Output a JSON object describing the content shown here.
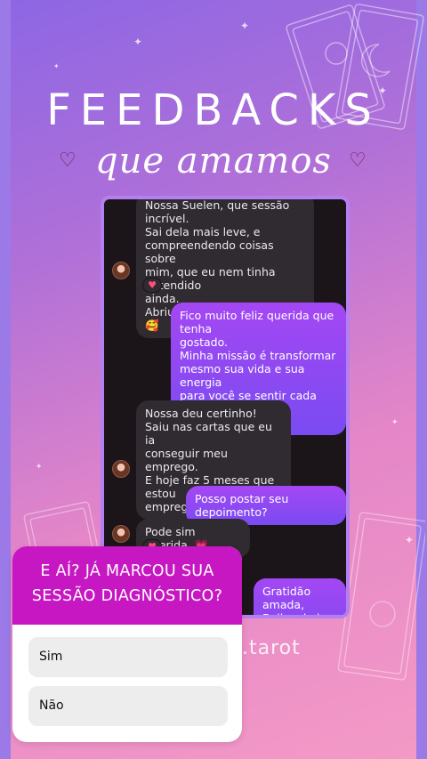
{
  "story": {
    "headline": "FEEDBACKS",
    "subheadline": "que amamos",
    "brand_watermark": ".tarot",
    "decorations": {
      "heart_left": "heart-outline-icon",
      "heart_right": "heart-outline-icon",
      "tarot_cards": [
        "THE MOON",
        "THE TOWER"
      ]
    }
  },
  "chat": {
    "messages": [
      {
        "from": "client",
        "text": "Nossa Suelen, que sessão incrível.\nSai dela mais leve, e\ncompreendendo coisas sobre\nmim, que eu nem tinha entendido\nainda.\nAbriu minha visão mesmo 🥰",
        "reaction": "♥"
      },
      {
        "from": "reader",
        "text": "Fico muito feliz querida que tenha\ngostado.\nMinha missão é transformar\nmesmo sua vida e sua energia\npara você se sentir cada vez mais\nrealizada."
      },
      {
        "from": "client",
        "text": "Nossa deu certinho!\nSaiu nas cartas que eu ia\nconseguir meu emprego.\nE hoje faz 5 meses que estou\nempregada Gratidão 🥺"
      },
      {
        "from": "reader",
        "text": "Posso postar seu depoimento?"
      },
      {
        "from": "client",
        "text": "Pode sim querida. 💗",
        "reaction": "♥"
      },
      {
        "from": "reader",
        "text": "Gratidão amada,\nBeijos de luz 🌟"
      }
    ]
  },
  "poll": {
    "question": "E AÍ? JÁ MARCOU SUA SESSÃO DIAGNÓSTICO?",
    "options": [
      "Sim",
      "Não"
    ],
    "header_color": "#c617c2"
  },
  "colors": {
    "gradient_top": "#8d66e4",
    "gradient_bottom": "#f49ac6",
    "chat_border": "#b47ff0",
    "outgoing_bubble": "#8f47f3"
  }
}
